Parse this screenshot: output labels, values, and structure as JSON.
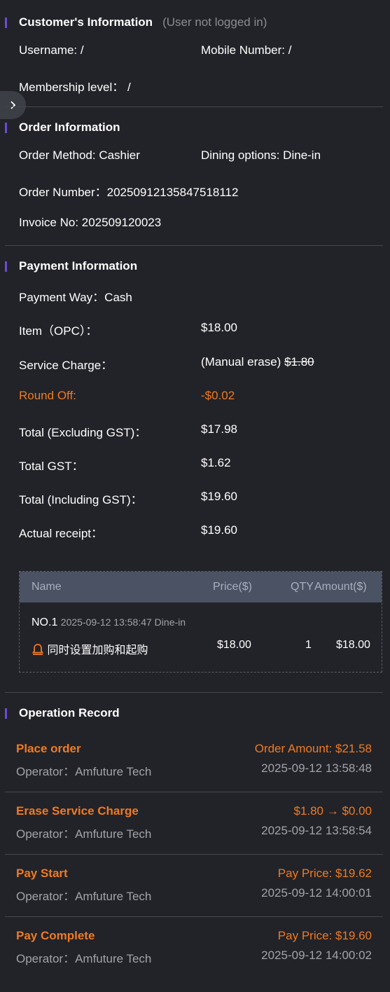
{
  "customer": {
    "title": "Customer's Information",
    "note": "(User not logged in)",
    "username": "Username: /",
    "mobile": "Mobile Number: /",
    "membership": "Membership level： /"
  },
  "order": {
    "title": "Order Information",
    "method": "Order Method: Cashier",
    "dining": "Dining options: Dine-in",
    "number": "Order Number：20250912135847518112",
    "invoice": "Invoice No: 202509120023"
  },
  "payment": {
    "title": "Payment Information",
    "way": "Payment Way：Cash",
    "item_label": "Item（OPC）：",
    "item_value": "$18.00",
    "service_label": "Service Charge：",
    "service_note": "(Manual erase)",
    "service_value": "$1.80",
    "round_label": "Round Off:",
    "round_value": "-$0.02",
    "total_ex_label": "Total (Excluding GST)：",
    "total_ex_value": "$17.98",
    "gst_label": "Total GST：",
    "gst_value": "$1.62",
    "total_in_label": "Total (Including GST)：",
    "total_in_value": "$19.60",
    "actual_label": "Actual receipt：",
    "actual_value": "$19.60"
  },
  "table": {
    "headers": [
      "Name",
      "Price($)",
      "QTY",
      "Amount($)"
    ],
    "group_no": "NO.1",
    "group_meta": "2025-09-12 13:58:47 Dine-in",
    "item_name": "同时设置加购和起购",
    "item_price": "$18.00",
    "item_qty": "1",
    "item_amount": "$18.00"
  },
  "operations": {
    "title": "Operation Record",
    "records": [
      {
        "action": "Place order",
        "detail": "Order Amount: $21.58",
        "operator": "Operator：Amfuture Tech",
        "time": "2025-09-12 13:58:48"
      },
      {
        "action": "Erase Service Charge",
        "detail": "$1.80 → $0.00",
        "operator": "Operator：Amfuture Tech",
        "time": "2025-09-12 13:58:54"
      },
      {
        "action": "Pay Start",
        "detail": "Pay Price: $19.62",
        "operator": "Operator：Amfuture Tech",
        "time": "2025-09-12 14:00:01"
      },
      {
        "action": "Pay Complete",
        "detail": "Pay Price: $19.60",
        "operator": "Operator：Amfuture Tech",
        "time": "2025-09-12 14:00:02"
      }
    ]
  },
  "colors": {
    "background": "#222328",
    "accent_bar": "#6a4cd6",
    "orange": "#f07a22",
    "table_header": "#4a5263"
  },
  "icons": {
    "toggle": "chevron-right-icon",
    "item": "bell-icon"
  }
}
